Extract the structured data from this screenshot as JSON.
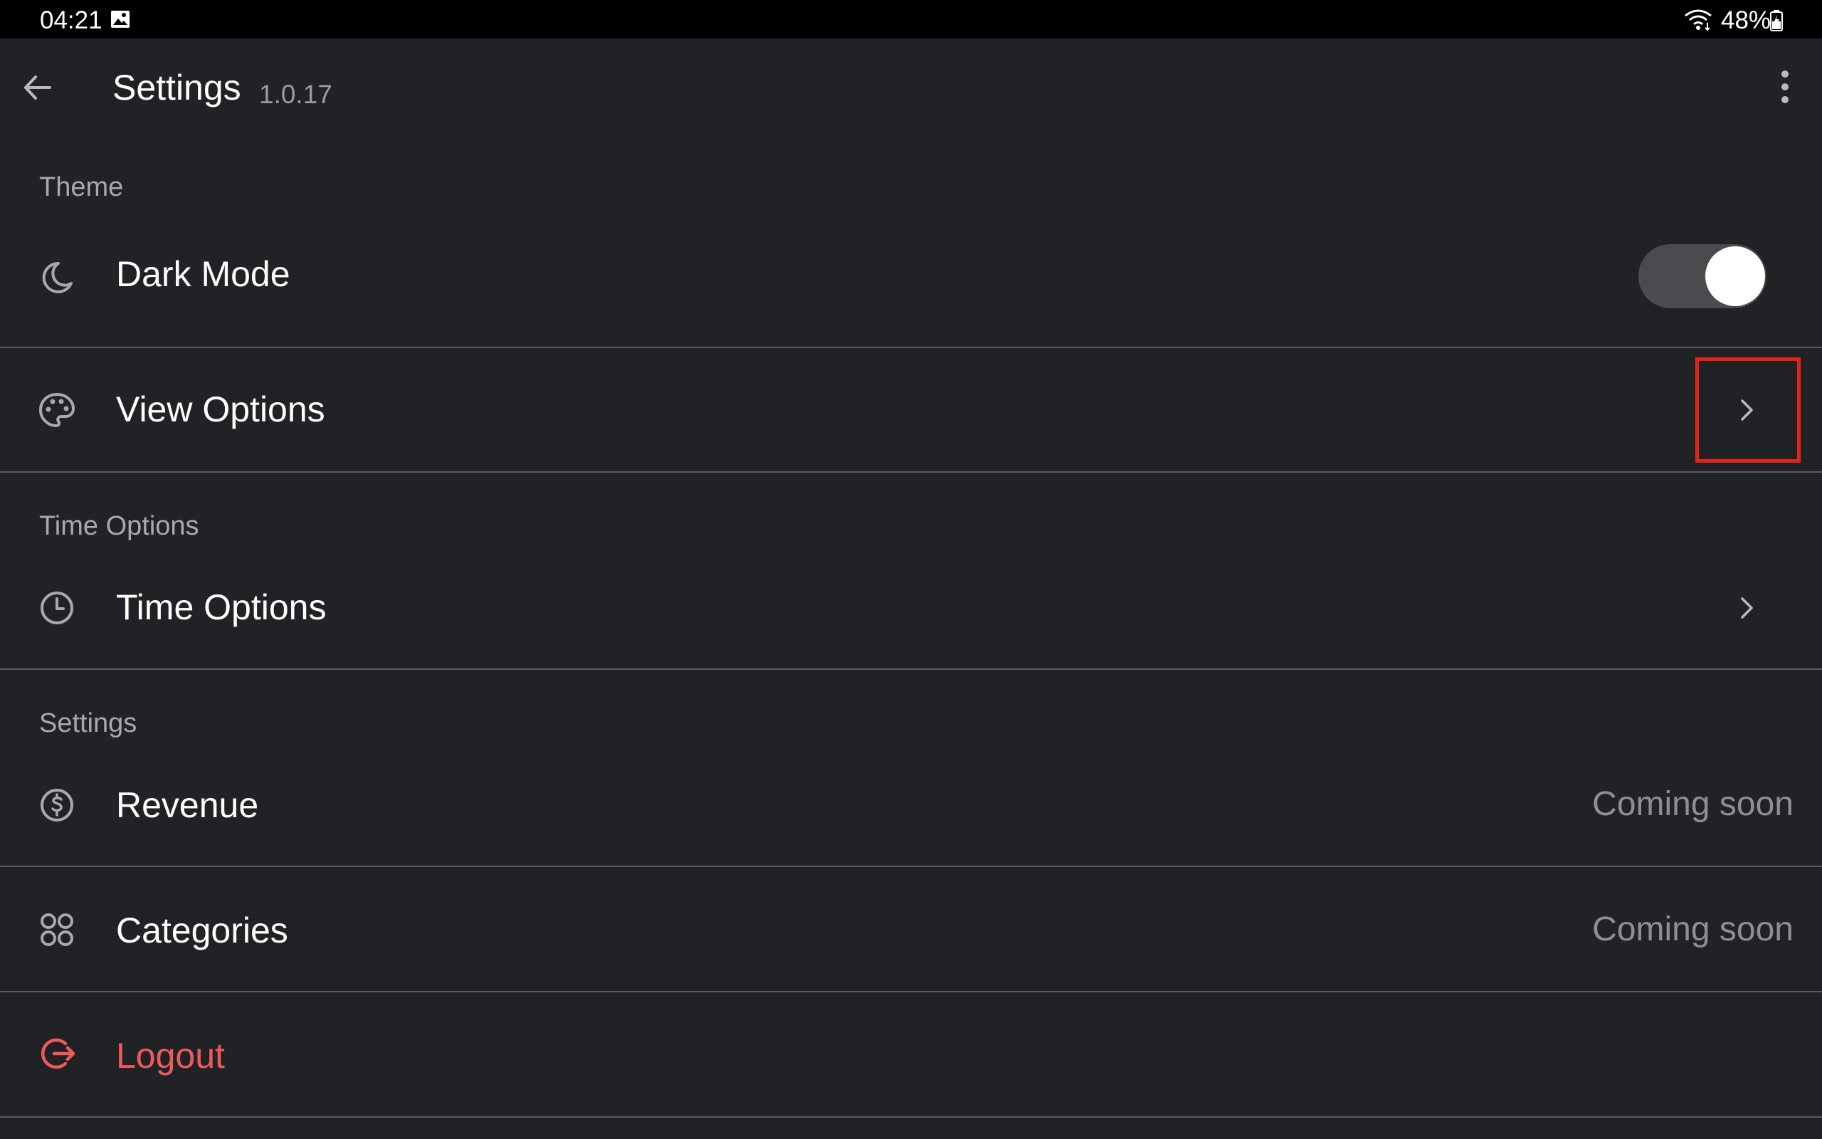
{
  "status_bar": {
    "time": "04:21",
    "battery": "48%"
  },
  "app_bar": {
    "title": "Settings",
    "version": "1.0.17"
  },
  "sections": {
    "theme_header": "Theme",
    "time_header": "Time Options",
    "settings_header": "Settings"
  },
  "rows": {
    "dark_mode": {
      "label": "Dark Mode",
      "icon": "moon-icon",
      "toggle_on": true
    },
    "view_options": {
      "label": "View Options",
      "icon": "palette-icon"
    },
    "time_options": {
      "label": "Time Options",
      "icon": "clock-icon"
    },
    "revenue": {
      "label": "Revenue",
      "icon": "dollar-circle-icon",
      "trailing": "Coming soon"
    },
    "categories": {
      "label": "Categories",
      "icon": "grid-circles-icon",
      "trailing": "Coming soon"
    },
    "logout": {
      "label": "Logout",
      "icon": "logout-icon"
    }
  },
  "colors": {
    "background": "#212226",
    "text_primary": "#ffffff",
    "text_secondary": "#a7a9ae",
    "danger": "#ef5b5b",
    "highlight": "#e2231a"
  }
}
